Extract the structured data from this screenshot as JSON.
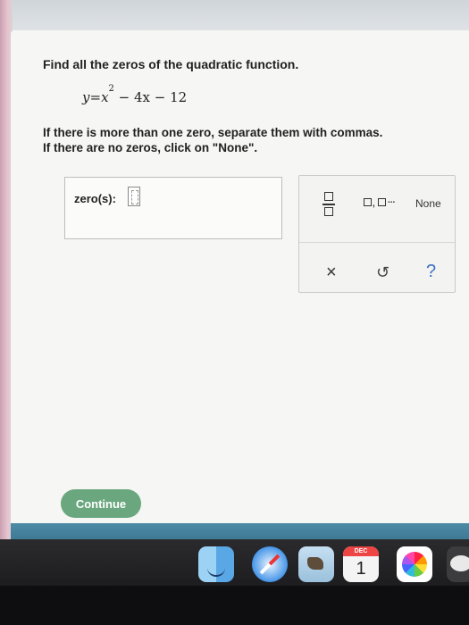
{
  "question": {
    "prompt": "Find all the zeros of the quadratic function.",
    "equation": {
      "lhs": "y",
      "eq": "=",
      "x_var": "x",
      "exponent": "2",
      "rest": " − 4x − 12"
    },
    "instruction_line1": "If there is more than one zero, separate them with commas.",
    "instruction_line2": "If there are no zeros, click on \"None\"."
  },
  "answer": {
    "label": "zero(s):",
    "value": ""
  },
  "toolpad": {
    "list_comma": ",",
    "list_dots": "...",
    "none_label": "None",
    "clear_symbol": "×",
    "undo_symbol": "↺",
    "help_symbol": "?"
  },
  "footer": {
    "continue_label": "Continue"
  },
  "dock": {
    "calendar_month": "DEC",
    "calendar_day": "1"
  },
  "colors": {
    "continue_green": "#6aa77f",
    "help_blue": "#3b6fc4",
    "screen_bg": "#f6f6f4"
  }
}
